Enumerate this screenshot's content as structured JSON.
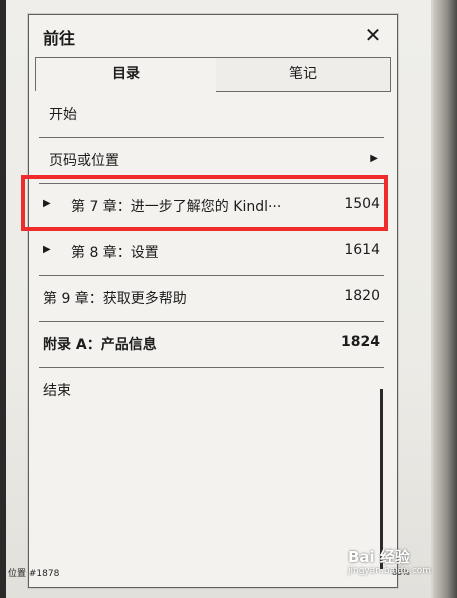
{
  "dialog": {
    "title": "前往",
    "close_icon": "✕",
    "tabs": [
      {
        "label": "目录",
        "active": true
      },
      {
        "label": "笔记",
        "active": false
      }
    ],
    "items": [
      {
        "label": "开始",
        "page": "",
        "expand": false,
        "submenu": false,
        "bold": false
      },
      {
        "label": "页码或位置",
        "page": "",
        "expand": false,
        "submenu": true,
        "bold": false
      },
      {
        "label": "第 7 章：进一步了解您的 Kindl···",
        "page": "1504",
        "expand": true,
        "submenu": false,
        "bold": false
      },
      {
        "label": "第 8 章：设置",
        "page": "1614",
        "expand": true,
        "submenu": false,
        "bold": false
      },
      {
        "label": "第 9 章：获取更多帮助",
        "page": "1820",
        "expand": false,
        "submenu": false,
        "bold": false
      },
      {
        "label": "附录 A：产品信息",
        "page": "1824",
        "expand": false,
        "submenu": false,
        "bold": true
      },
      {
        "label": "结束",
        "page": "",
        "expand": false,
        "submenu": false,
        "bold": false
      }
    ]
  },
  "footer": {
    "location": "位置 #1878",
    "percent": "85%"
  },
  "watermark": {
    "line1": "Bai 经验",
    "line2": "jingyan.baidu.com"
  },
  "highlight_color": "#ef2b2b"
}
